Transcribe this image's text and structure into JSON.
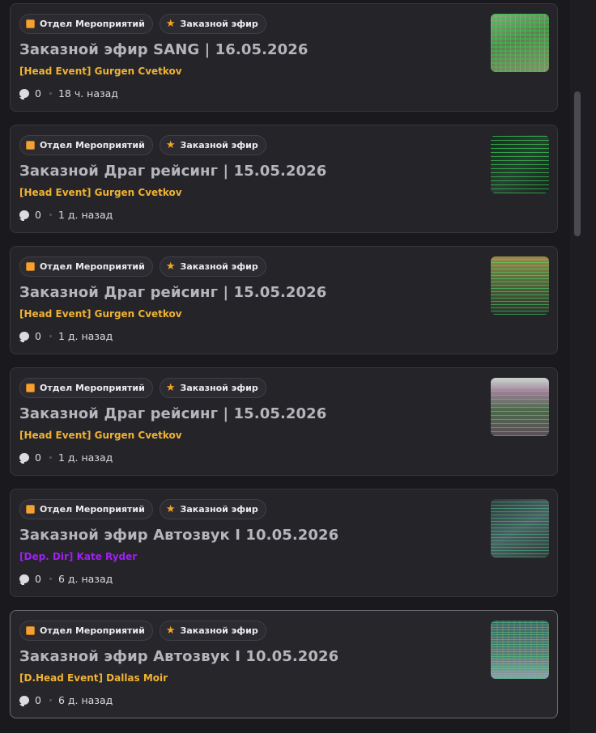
{
  "posts": [
    {
      "tags": [
        "Отдел Мероприятий",
        "Заказной эфир"
      ],
      "title": "Заказной эфир SANG | 16.05.2026",
      "author": "[Head Event] Gurgen Cvetkov",
      "author_color": "#f0b232",
      "comments": "0",
      "time": "18 ч. назад"
    },
    {
      "tags": [
        "Отдел Мероприятий",
        "Заказной эфир"
      ],
      "title": "Заказной Драг рейсинг | 15.05.2026",
      "author": "[Head Event] Gurgen Cvetkov",
      "author_color": "#f0b232",
      "comments": "0",
      "time": "1 д. назад"
    },
    {
      "tags": [
        "Отдел Мероприятий",
        "Заказной эфир"
      ],
      "title": "Заказной Драг рейсинг | 15.05.2026",
      "author": "[Head Event] Gurgen Cvetkov",
      "author_color": "#f0b232",
      "comments": "0",
      "time": "1 д. назад"
    },
    {
      "tags": [
        "Отдел Мероприятий",
        "Заказной эфир"
      ],
      "title": "Заказной Драг рейсинг | 15.05.2026",
      "author": "[Head Event] Gurgen Cvetkov",
      "author_color": "#f0b232",
      "comments": "0",
      "time": "1 д. назад"
    },
    {
      "tags": [
        "Отдел Мероприятий",
        "Заказной эфир"
      ],
      "title": "Заказной эфир Автозвук I 10.05.2026",
      "author": "[Dep. Dir] Kate Ryder",
      "author_color": "#a020f0",
      "comments": "0",
      "time": "6 д. назад"
    },
    {
      "tags": [
        "Отдел Мероприятий",
        "Заказной эфир"
      ],
      "title": "Заказной эфир Автозвук I 10.05.2026",
      "author": "[D.Head Event] Dallas Moir",
      "author_color": "#f0b232",
      "comments": "0",
      "time": "6 д. назад"
    }
  ],
  "tag_icons": [
    "department-icon",
    "star-icon"
  ]
}
